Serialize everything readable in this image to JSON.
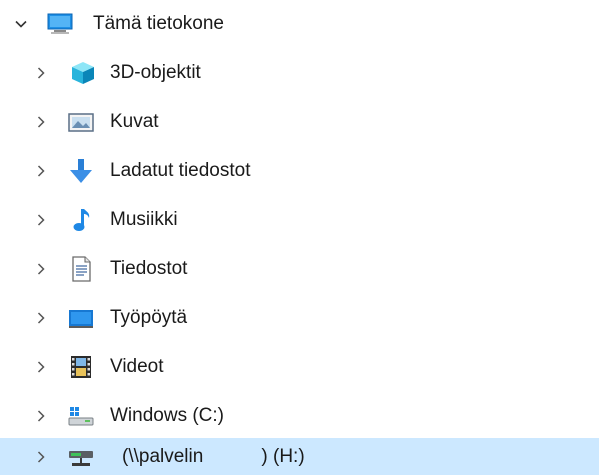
{
  "tree": {
    "root": {
      "label": "Tämä tietokone",
      "icon": "computer-icon",
      "expanded": true
    },
    "items": [
      {
        "label": "3D-objektit",
        "icon": "cube-3d-icon"
      },
      {
        "label": "Kuvat",
        "icon": "pictures-icon"
      },
      {
        "label": "Ladatut tiedostot",
        "icon": "download-arrow-icon"
      },
      {
        "label": "Musiikki",
        "icon": "music-note-icon"
      },
      {
        "label": "Tiedostot",
        "icon": "documents-icon"
      },
      {
        "label": "Työpöytä",
        "icon": "desktop-icon"
      },
      {
        "label": "Videot",
        "icon": "film-icon"
      },
      {
        "label": "Windows (C:)",
        "icon": "windows-drive-icon"
      },
      {
        "label": "(\\\\palvelin           ) (H:)",
        "icon": "network-drive-icon",
        "selected": true
      }
    ]
  },
  "colors": {
    "selection": "#cce8ff",
    "accent": "#0078d7"
  }
}
